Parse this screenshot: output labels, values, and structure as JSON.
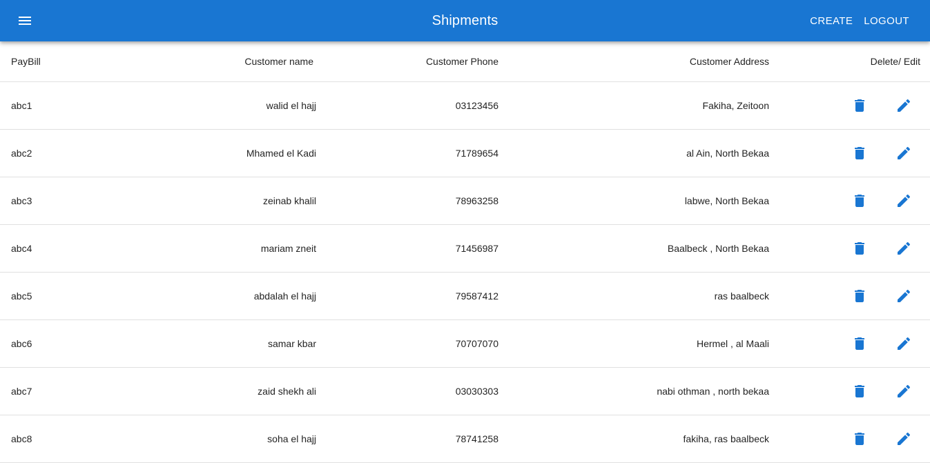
{
  "appbar": {
    "title": "Shipments",
    "menu_icon": "menu-icon",
    "create_label": "CREATE",
    "logout_label": "LOGOUT",
    "color": "#1976d2"
  },
  "table": {
    "headers": {
      "paybill": "PayBill",
      "name": "Customer name",
      "phone": "Customer Phone",
      "address": "Customer Address",
      "actions": "Delete/ Edit"
    },
    "action_icons": [
      "delete-icon",
      "edit-icon"
    ],
    "icon_color": "#1976d2",
    "rows": [
      {
        "paybill": "abc1",
        "name": "walid el hajj",
        "phone": "03123456",
        "address": "Fakiha, Zeitoon"
      },
      {
        "paybill": "abc2",
        "name": "Mhamed el Kadi",
        "phone": "71789654",
        "address": "al Ain, North Bekaa"
      },
      {
        "paybill": "abc3",
        "name": "zeinab khalil",
        "phone": "78963258",
        "address": "labwe, North Bekaa"
      },
      {
        "paybill": "abc4",
        "name": "mariam zneit",
        "phone": "71456987",
        "address": "Baalbeck , North Bekaa"
      },
      {
        "paybill": "abc5",
        "name": "abdalah el hajj",
        "phone": "79587412",
        "address": "ras baalbeck"
      },
      {
        "paybill": "abc6",
        "name": "samar kbar",
        "phone": "70707070",
        "address": "Hermel , al Maali"
      },
      {
        "paybill": "abc7",
        "name": "zaid shekh ali",
        "phone": "03030303",
        "address": "nabi othman , north bekaa"
      },
      {
        "paybill": "abc8",
        "name": "soha el hajj",
        "phone": "78741258",
        "address": "fakiha, ras baalbeck"
      }
    ]
  }
}
